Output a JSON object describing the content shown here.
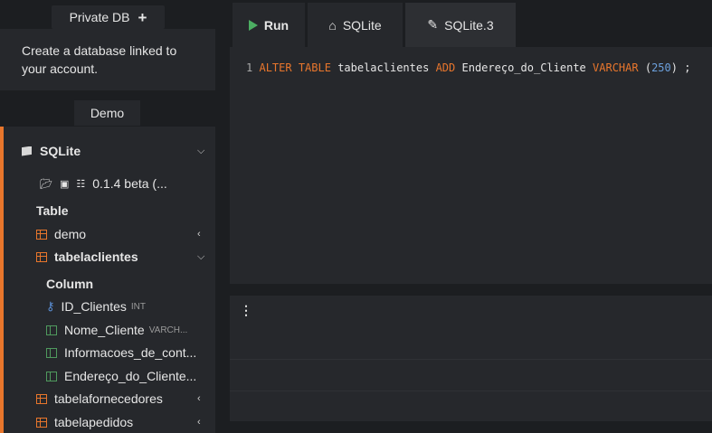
{
  "sidebar": {
    "private_db_label": "Private DB",
    "info_text": "Create a database linked to your account.",
    "demo_label": "Demo",
    "db": {
      "name": "SQLite",
      "version": "0.1.4 beta (...",
      "table_heading": "Table",
      "tables": [
        {
          "name": "demo"
        },
        {
          "name": "tabelaclientes"
        },
        {
          "name": "tabelafornecedores"
        },
        {
          "name": "tabelapedidos"
        }
      ],
      "column_heading": "Column",
      "columns": [
        {
          "name": "ID_Clientes",
          "type": "INT"
        },
        {
          "name": "Nome_Cliente",
          "type": "VARCH..."
        },
        {
          "name": "Informacoes_de_cont..."
        },
        {
          "name": "Endereço_do_Cliente..."
        }
      ]
    }
  },
  "tabs": {
    "run": "Run",
    "sqlite": "SQLite",
    "sqlite3": "SQLite.3"
  },
  "editor": {
    "line_number": "1",
    "kw1": "ALTER TABLE",
    "ident1": "tabelaclientes",
    "kw2": "ADD",
    "ident2": "Endereço_do_Cliente",
    "kw3": "VARCHAR",
    "paren_open": "(",
    "num": "250",
    "paren_close": ") ;"
  },
  "results": {
    "menu_icon": "⋮"
  },
  "colors": {
    "accent": "#e8762c",
    "run_green": "#4cae62",
    "column_green": "#4f9a5e",
    "key_blue": "#5b8fd6"
  }
}
